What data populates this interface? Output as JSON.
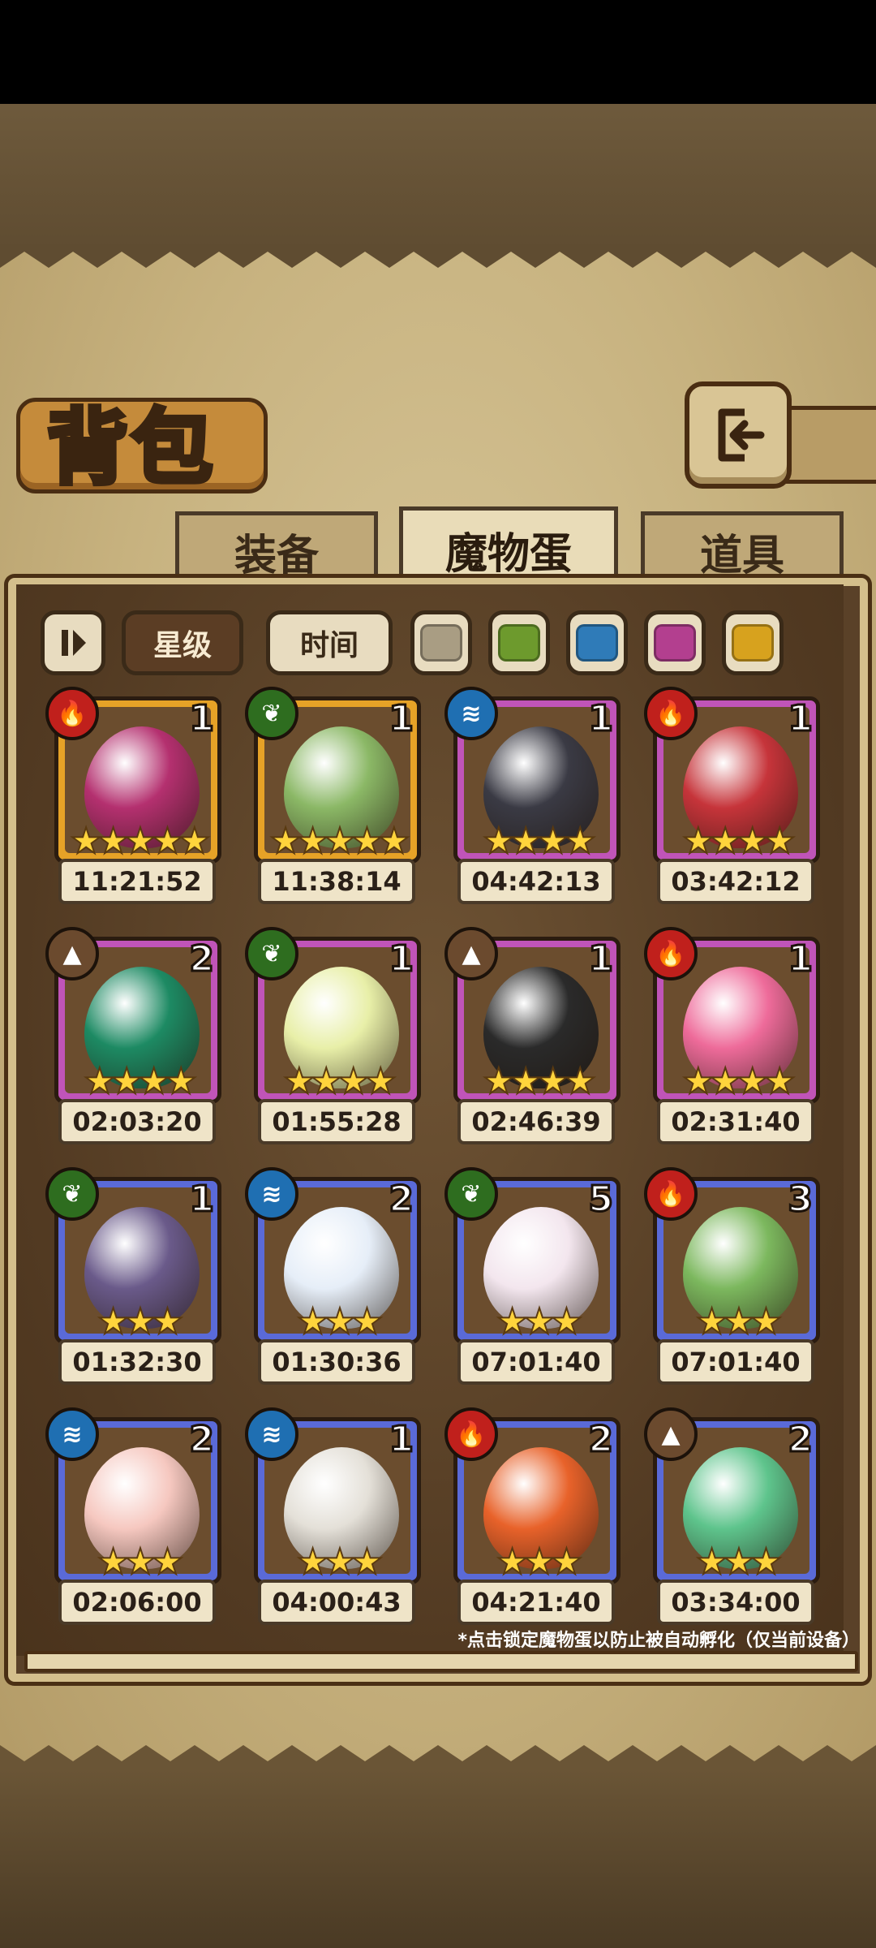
{
  "header": {
    "title": "背包",
    "back_icon": "return-arrow-icon"
  },
  "tabs": [
    {
      "label": "装备",
      "active": false
    },
    {
      "label": "魔物蛋",
      "active": true
    },
    {
      "label": "道具",
      "active": false
    }
  ],
  "filters": {
    "sort_star": "星级",
    "sort_time": "时间",
    "swatches": [
      "#a99d83",
      "#6d9a2d",
      "#2f7bb8",
      "#b33f8f",
      "#d7a21e"
    ]
  },
  "eggs": [
    {
      "element": "fire",
      "count": "1",
      "stars": "★★★★★",
      "timer": "11:21:52",
      "frame": "#e6a227",
      "egg_color": "#b4306f"
    },
    {
      "element": "leaf",
      "count": "1",
      "stars": "★★★★★",
      "timer": "11:38:14",
      "frame": "#e6a227",
      "egg_color": "#8bb866"
    },
    {
      "element": "water",
      "count": "1",
      "stars": "★★★★",
      "timer": "04:42:13",
      "frame": "#c054b8",
      "egg_color": "#3a3a44"
    },
    {
      "element": "fire",
      "count": "1",
      "stars": "★★★★",
      "timer": "03:42:12",
      "frame": "#c054b8",
      "egg_color": "#c6343a"
    },
    {
      "element": "earth",
      "count": "2",
      "stars": "★★★★",
      "timer": "02:03:20",
      "frame": "#c054b8",
      "egg_color": "#1d8a63"
    },
    {
      "element": "leaf",
      "count": "1",
      "stars": "★★★★",
      "timer": "01:55:28",
      "frame": "#c054b8",
      "egg_color": "#e8efa8"
    },
    {
      "element": "earth",
      "count": "1",
      "stars": "★★★★",
      "timer": "02:46:39",
      "frame": "#c054b8",
      "egg_color": "#2a2a2a"
    },
    {
      "element": "fire",
      "count": "1",
      "stars": "★★★★",
      "timer": "02:31:40",
      "frame": "#c054b8",
      "egg_color": "#ee6b9a"
    },
    {
      "element": "leaf",
      "count": "1",
      "stars": "★★★",
      "timer": "01:32:30",
      "frame": "#5a6ad8",
      "egg_color": "#6a5a8a"
    },
    {
      "element": "water",
      "count": "2",
      "stars": "★★★",
      "timer": "01:30:36",
      "frame": "#5a6ad8",
      "egg_color": "#e6eef8"
    },
    {
      "element": "leaf",
      "count": "5",
      "stars": "★★★",
      "timer": "07:01:40",
      "frame": "#5a6ad8",
      "egg_color": "#f3e6ee"
    },
    {
      "element": "fire",
      "count": "3",
      "stars": "★★★",
      "timer": "07:01:40",
      "frame": "#5a6ad8",
      "egg_color": "#7cb85e"
    },
    {
      "element": "water",
      "count": "2",
      "stars": "★★★",
      "timer": "02:06:00",
      "frame": "#5a6ad8",
      "egg_color": "#f6c8c0"
    },
    {
      "element": "water",
      "count": "1",
      "stars": "★★★",
      "timer": "04:00:43",
      "frame": "#5a6ad8",
      "egg_color": "#e4e0d8"
    },
    {
      "element": "fire",
      "count": "2",
      "stars": "★★★",
      "timer": "04:21:40",
      "frame": "#5a6ad8",
      "egg_color": "#e8622a"
    },
    {
      "element": "earth",
      "count": "2",
      "stars": "★★★",
      "timer": "03:34:00",
      "frame": "#5a6ad8",
      "egg_color": "#5ec48c"
    }
  ],
  "footnote": "*点击锁定魔物蛋以防止被自动孵化（仅当前设备）",
  "element_colors": {
    "fire": "#c0201c",
    "leaf": "#2e6d1f",
    "water": "#1f6fb2",
    "earth": "#6b4a2e"
  },
  "element_glyphs": {
    "fire": "🔥",
    "leaf": "❦",
    "water": "≋",
    "earth": "▲"
  }
}
